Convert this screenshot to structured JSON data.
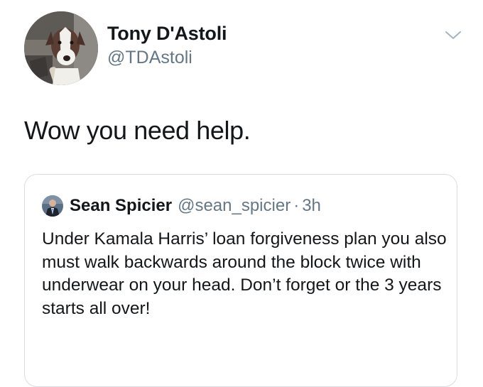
{
  "tweet": {
    "author": {
      "display_name": "Tony D'Astoli",
      "handle": "@TDAstoli",
      "avatar": "dog-photo-avatar"
    },
    "menu_icon": "chevron-down-icon",
    "text": "Wow you need help.",
    "quoted_tweet": {
      "author": {
        "display_name": "Sean Spicier",
        "handle": "@sean_spicier",
        "avatar": "man-in-suit-avatar"
      },
      "separator": "·",
      "time": "3h",
      "text": "Under Kamala Harris’ loan forgiveness plan you also must walk backwards around the block twice with underwear on your head. Don’t forget or the 3 years starts all over!"
    }
  },
  "colors": {
    "primary_text": "#14171a",
    "secondary_text": "#657786",
    "card_border": "#d7dde2",
    "background": "#ffffff"
  }
}
